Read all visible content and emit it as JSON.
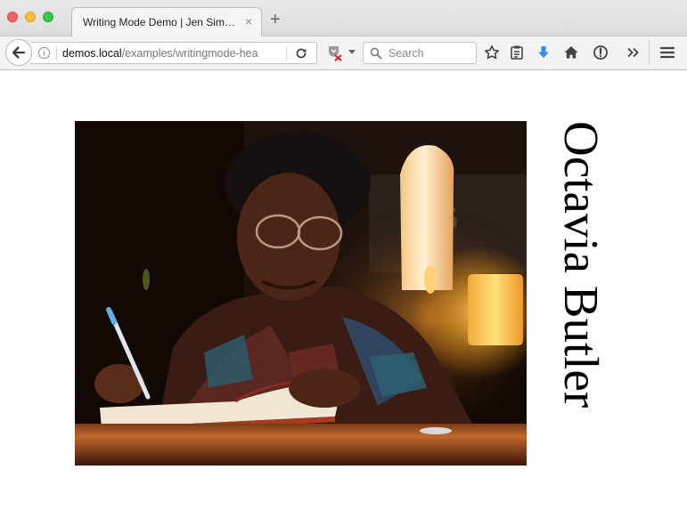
{
  "browser": {
    "tab": {
      "title": "Writing Mode Demo | Jen Simmons Labs",
      "close_glyph": "×"
    },
    "new_tab_glyph": "+",
    "address_bar": {
      "host": "demos.local",
      "path": "/examples/writingmode-hea"
    },
    "search": {
      "placeholder": "Search"
    },
    "toolbar_icons": [
      "back-icon",
      "info-icon",
      "reload-icon",
      "pocket-icon",
      "search-icon",
      "bookmark-star-icon",
      "reading-list-icon",
      "downloads-icon",
      "home-icon",
      "sync-icon",
      "overflow-icon",
      "menu-icon"
    ]
  },
  "page": {
    "heading": "Octavia Butler",
    "photo": "photo of a woman with glasses signing a book by candlelight"
  },
  "colors": {
    "download_arrow": "#2f8ff0",
    "close": "#fc605b",
    "minimize": "#fdbc40",
    "maximize": "#34c84a"
  }
}
